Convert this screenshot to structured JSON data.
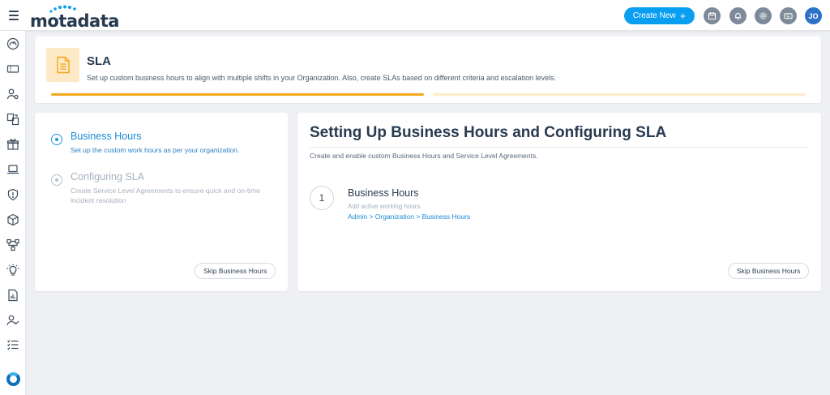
{
  "app": {
    "logo_text": "motadata",
    "brand_color": "#0a9ef0"
  },
  "topbar": {
    "create_new_label": "Create New",
    "icons": [
      "calendar-icon",
      "bell-icon",
      "gear-icon",
      "keyboard-icon"
    ],
    "avatar_initials": "JO"
  },
  "sidebar": {
    "items": [
      "dashboard-icon",
      "ticket-icon",
      "user-settings-icon",
      "change-icon",
      "gift-icon",
      "laptop-icon",
      "shield-icon",
      "cube-icon",
      "workflow-icon",
      "bulb-icon",
      "report-icon",
      "user-check-icon",
      "checklist-icon"
    ]
  },
  "header": {
    "title": "SLA",
    "subtitle": "Set up custom business hours to align with multiple shifts in your Organization. Also, create SLAs based on different criteria and escalation levels.",
    "progress_steps": 2,
    "progress_completed": 1,
    "accent": "#f4a81d"
  },
  "steps": {
    "items": [
      {
        "title": "Business Hours",
        "description": "Set up the custom work hours as per your organization.",
        "active": true
      },
      {
        "title": "Configuring SLA",
        "description": "Create Service Level Agreements to ensure quick and on-time incident resolution",
        "active": false
      }
    ],
    "skip_label": "Skip Business Hours"
  },
  "content": {
    "title": "Setting Up Business Hours and Configuring SLA",
    "subtitle": "Create and enable custom Business Hours and Service Level Agreements.",
    "step_number": "1",
    "step_title": "Business Hours",
    "step_subtitle": "Add active working hours.",
    "step_path": "Admin > Organization > Business Hours",
    "skip_label": "Skip Business Hours"
  }
}
